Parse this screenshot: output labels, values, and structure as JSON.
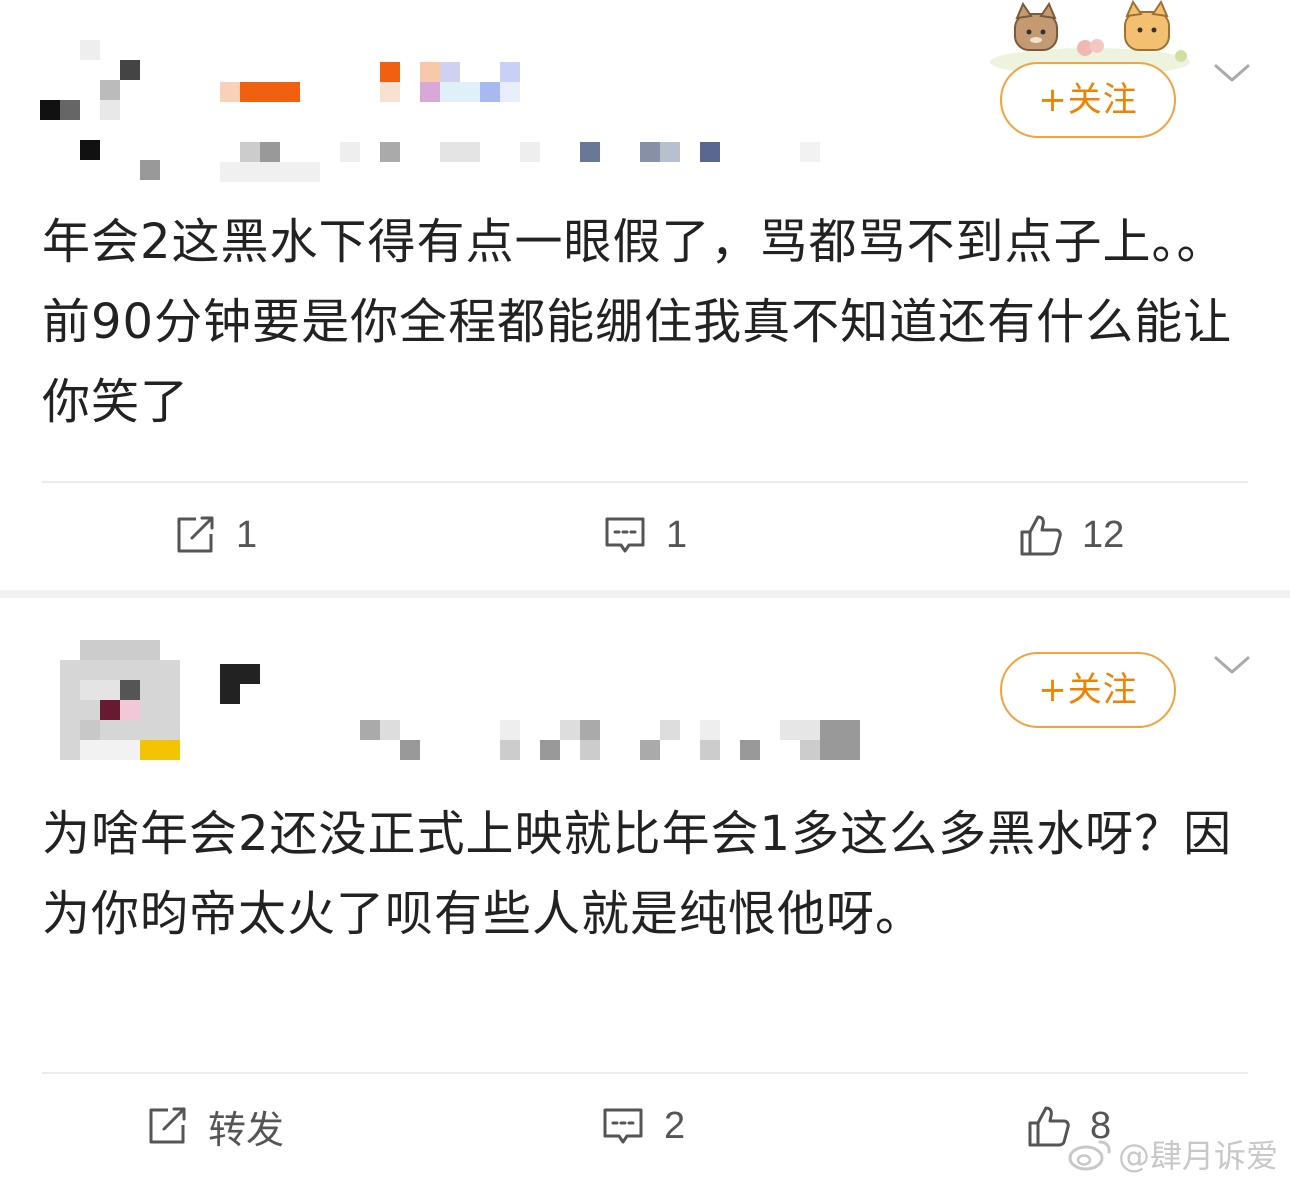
{
  "colors": {
    "accent": "#f08200",
    "follow_border": "#f5a23c",
    "text": "#222222",
    "icon": "#555555",
    "divider": "#ececec"
  },
  "posts": [
    {
      "follow_label": "+关注",
      "content": "年会2这黑水下得有点一眼假了，骂都骂不到点子上。。前90分钟要是你全程都能绷住我真不知道还有什么能让你笑了",
      "actions": {
        "repost": {
          "icon": "repost-icon",
          "value": "1"
        },
        "comment": {
          "icon": "comment-icon",
          "value": "1"
        },
        "like": {
          "icon": "like-icon",
          "value": "12"
        }
      }
    },
    {
      "follow_label": "+关注",
      "content": "为啥年会2还没正式上映就比年会1多这么多黑水呀？因为你昀帝太火了呗有些人就是纯恨他呀。",
      "actions": {
        "repost": {
          "icon": "repost-icon",
          "value": "转发"
        },
        "comment": {
          "icon": "comment-icon",
          "value": "2"
        },
        "like": {
          "icon": "like-icon",
          "value": "8"
        }
      }
    }
  ],
  "watermark": "@肆月诉爱"
}
